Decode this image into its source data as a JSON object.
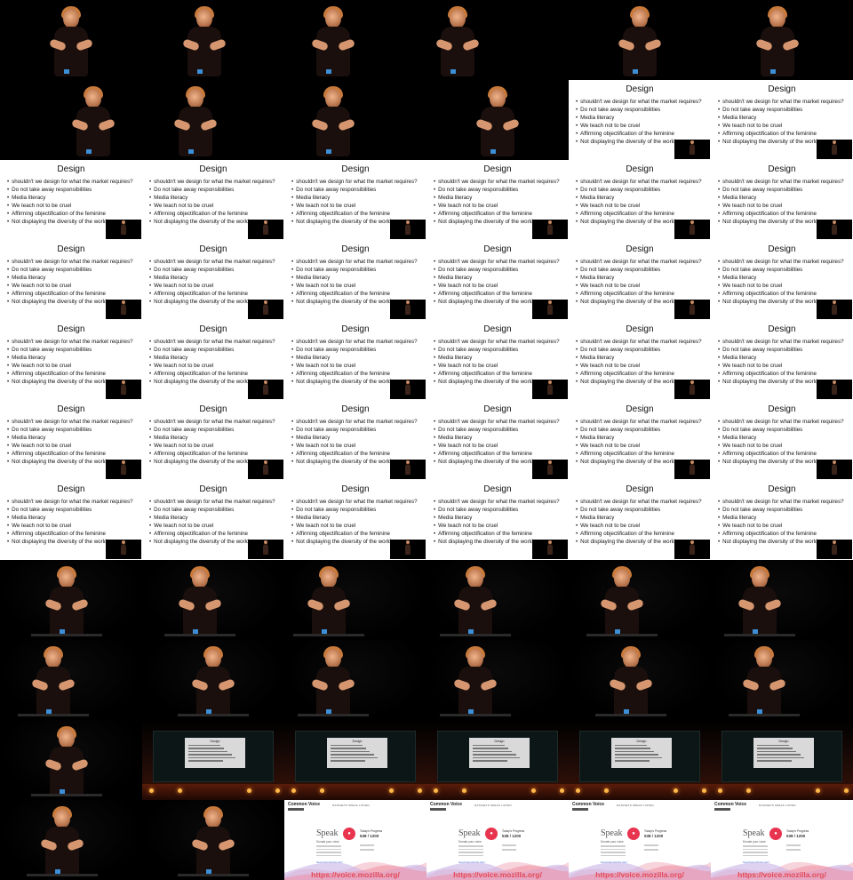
{
  "slide": {
    "title": "Design",
    "bullets": [
      "shouldn't we design for what the market requires?",
      "Do not take away responsibilities",
      "Media literacy",
      "We teach not to be cruel",
      "Affirming objectification of the feminine",
      "Not displaying the diversity of the world"
    ]
  },
  "stage_slide_title": "Design",
  "voice_site": {
    "brand": "Common Voice",
    "nav": "DATASETS   SPEAK   LISTEN",
    "speak_heading": "Speak",
    "speak_sub": "Donate your voice",
    "mic_icon": "microphone-icon",
    "stat_title": "Today's Progress",
    "stat_value": "538 / 1200",
    "link_text": "Need help with the site?",
    "url": "https://voice.mozilla.org/"
  },
  "colors": {
    "slide_background": "#ffffff",
    "stage_glow": "#3a1308",
    "mic_red": "#e8344e",
    "url_red": "#e44b5a"
  }
}
